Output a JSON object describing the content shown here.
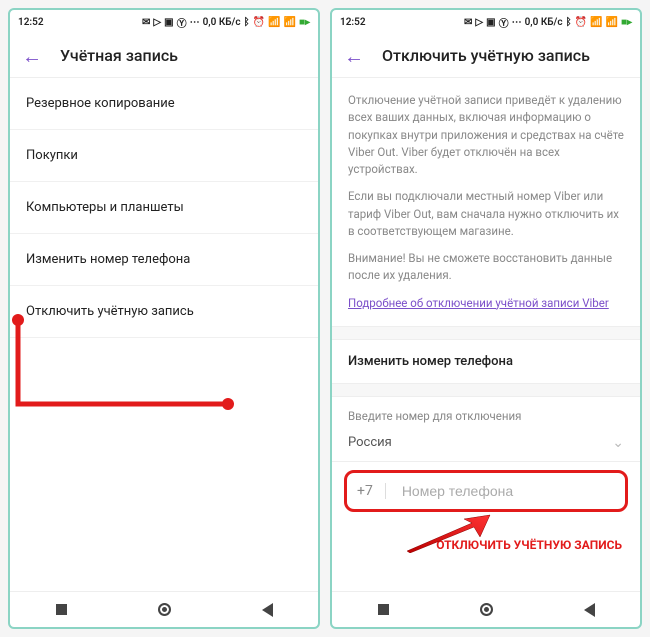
{
  "status": {
    "time": "12:52",
    "net": "0,0 КБ/с"
  },
  "left": {
    "title": "Учётная запись",
    "items": [
      "Резервное копирование",
      "Покупки",
      "Компьютеры и планшеты",
      "Изменить номер телефона",
      "Отключить учётную запись"
    ]
  },
  "right": {
    "title": "Отключить учётную запись",
    "desc1": "Отключение учётной записи приведёт к удалению всех ваших данных, включая информацию о покупках внутри приложения и средствах на счёте Viber Out. Viber будет отключён на всех устройствах.",
    "desc2": "Если вы подключали местный номер Viber или тариф Viber Out, вам сначала нужно отключить их в соответствующем магазине.",
    "desc3": "Внимание! Вы не сможете восстановить данные после их удаления.",
    "link": "Подробнее об отключении учётной записи Viber",
    "section": "Изменить номер телефона",
    "field_label": "Введите номер для отключения",
    "country": "Россия",
    "prefix": "+7",
    "placeholder": "Номер телефона",
    "action": "ОТКЛЮЧИТЬ УЧЁТНУЮ ЗАПИСЬ"
  }
}
